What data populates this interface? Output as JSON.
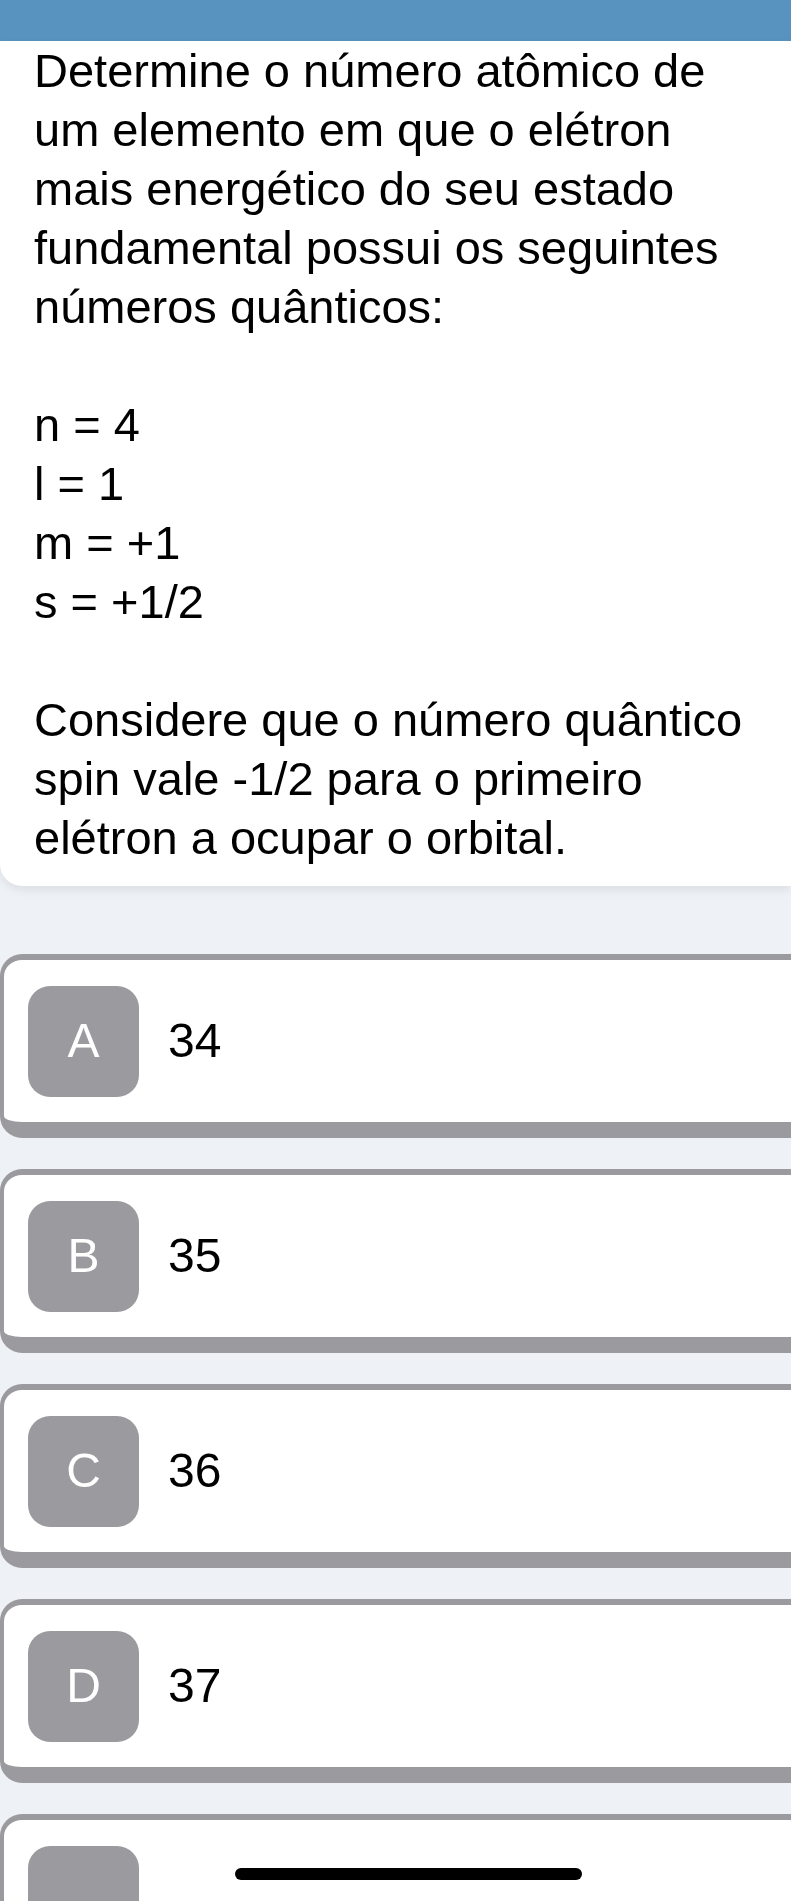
{
  "question": {
    "intro": "Determine o número atômico de um elemento em que o elétron mais energético do seu estado fundamental possui os seguintes números quânticos:",
    "quantum_numbers": [
      "n = 4",
      "l = 1",
      "m = +1",
      "s = +1/2"
    ],
    "note": "Considere que o número quântico spin vale -1/2 para o primeiro elétron a ocupar o orbital."
  },
  "options": [
    {
      "kind": "full",
      "letter": "A",
      "value": "34",
      "selected": false
    },
    {
      "kind": "full",
      "letter": "B",
      "value": "35",
      "selected": false
    },
    {
      "kind": "full",
      "letter": "C",
      "value": "36",
      "selected": false
    },
    {
      "kind": "full",
      "letter": "D",
      "value": "37",
      "selected": false
    },
    {
      "kind": "cut",
      "selected": false
    }
  ]
}
